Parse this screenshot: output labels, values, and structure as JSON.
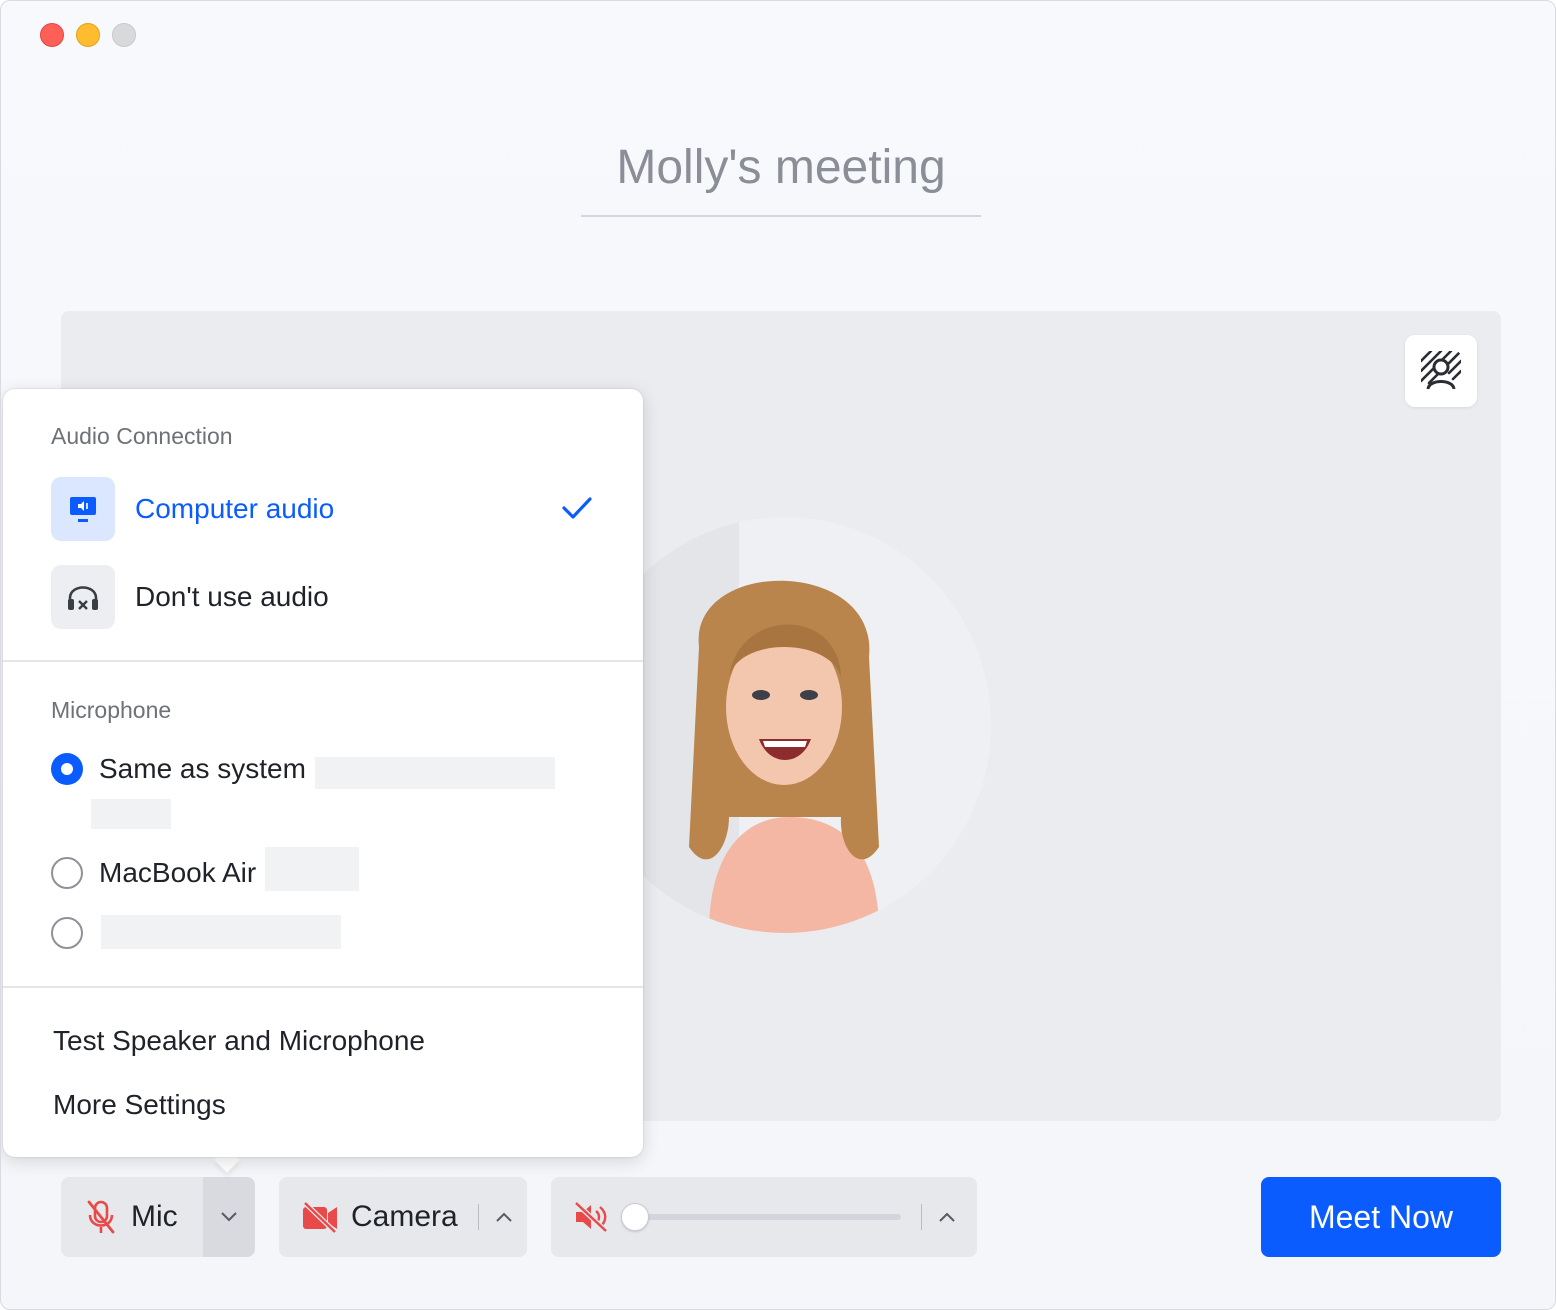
{
  "window": {
    "title_input": "Molly's meeting"
  },
  "audio_menu": {
    "connection_title": "Audio Connection",
    "options": [
      {
        "label": "Computer audio",
        "selected": true,
        "icon": "computer-audio-icon"
      },
      {
        "label": "Don't use audio",
        "selected": false,
        "icon": "headphones-off-icon"
      }
    ],
    "microphone_title": "Microphone",
    "microphones": [
      {
        "label": "Same as system",
        "selected": true
      },
      {
        "label": "MacBook Air",
        "selected": false
      },
      {
        "label": "",
        "selected": false
      }
    ],
    "test_label": "Test Speaker and Microphone",
    "settings_label": "More Settings"
  },
  "controls": {
    "mic_label": "Mic",
    "camera_label": "Camera",
    "speaker_volume": 0,
    "meet_now_label": "Meet Now"
  },
  "colors": {
    "accent": "#0b5cff",
    "muted_red": "#e84a4a"
  }
}
